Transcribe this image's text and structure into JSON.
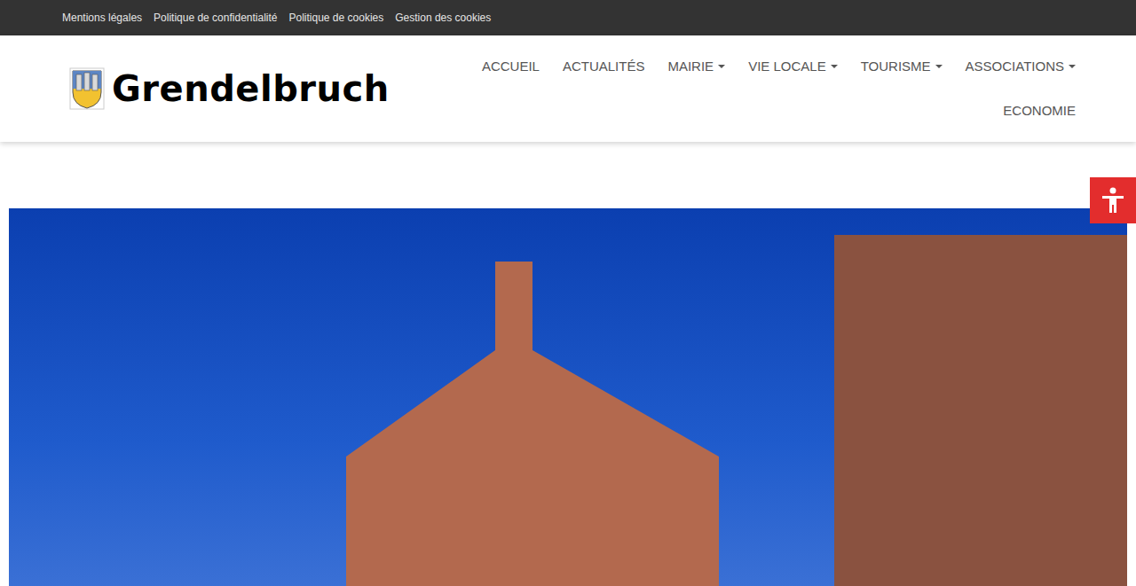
{
  "top_links": [
    "Mentions légales",
    "Politique de confidentialité",
    "Politique de cookies",
    "Gestion des cookies"
  ],
  "site": {
    "name": "Grendelbruch"
  },
  "nav": [
    {
      "label": "ACCUEIL",
      "dropdown": false
    },
    {
      "label": "ACTUALITÉS",
      "dropdown": false
    },
    {
      "label": "MAIRIE",
      "dropdown": true
    },
    {
      "label": "VIE LOCALE",
      "dropdown": true
    },
    {
      "label": "TOURISME",
      "dropdown": true
    },
    {
      "label": "ASSOCIATIONS",
      "dropdown": true
    },
    {
      "label": "ECONOMIE",
      "dropdown": false
    }
  ]
}
